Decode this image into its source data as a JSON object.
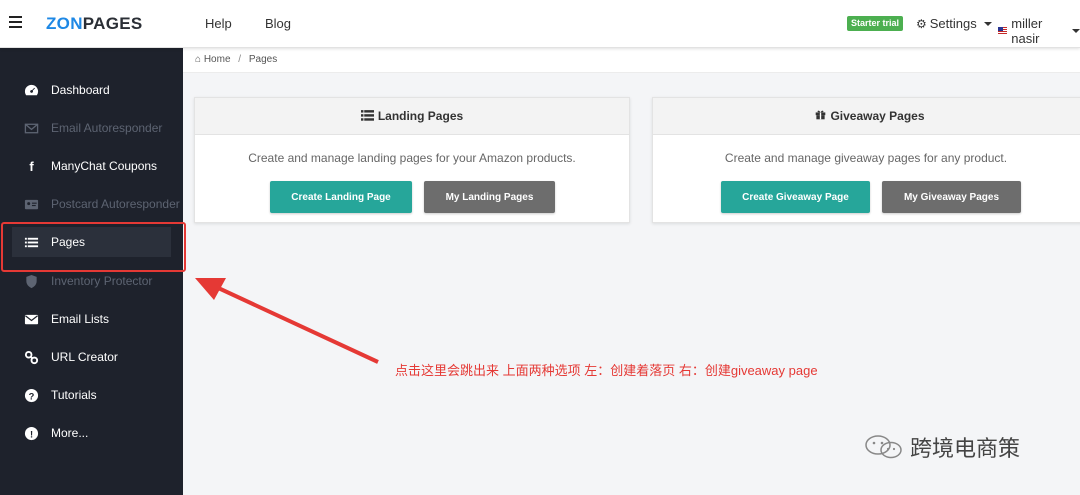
{
  "header": {
    "logo_zon": "ZON",
    "logo_pages": "PAGES",
    "nav": [
      "Help",
      "Blog"
    ],
    "trial_badge": "Starter trial",
    "settings_label": "Settings",
    "user_name": "miller nasir"
  },
  "sidebar": {
    "items": [
      {
        "label": "Dashboard",
        "icon": "dashboard-icon",
        "state": "normal"
      },
      {
        "label": "Email Autoresponder",
        "icon": "envelope-icon",
        "state": "dim"
      },
      {
        "label": "ManyChat Coupons",
        "icon": "facebook-icon",
        "state": "normal"
      },
      {
        "label": "Postcard Autoresponder",
        "icon": "address-card-icon",
        "state": "dim"
      },
      {
        "label": "Pages",
        "icon": "list-icon",
        "state": "active"
      },
      {
        "label": "Inventory Protector",
        "icon": "shield-icon",
        "state": "dim"
      },
      {
        "label": "Email Lists",
        "icon": "envelope-icon",
        "state": "normal"
      },
      {
        "label": "URL Creator",
        "icon": "link-icon",
        "state": "normal"
      },
      {
        "label": "Tutorials",
        "icon": "question-icon",
        "state": "normal"
      },
      {
        "label": "More...",
        "icon": "exclamation-icon",
        "state": "normal"
      }
    ]
  },
  "breadcrumb": {
    "home": "Home",
    "current": "Pages"
  },
  "cards": {
    "landing": {
      "title": "Landing Pages",
      "description": "Create and manage landing pages for your Amazon products.",
      "primary_button": "Create Landing Page",
      "secondary_button": "My Landing Pages"
    },
    "giveaway": {
      "title": "Giveaway Pages",
      "description": "Create and manage giveaway pages for any product.",
      "primary_button": "Create Giveaway Page",
      "secondary_button": "My Giveaway Pages"
    }
  },
  "annotation": "点击这里会跳出来 上面两种选项  左：创建着落页  右：创建giveaway page",
  "watermark": "跨境电商策",
  "colors": {
    "accent": "#1e88e5",
    "teal": "#26a69a",
    "sidebar": "#1e222c",
    "annotation": "#e53935",
    "badge": "#4caf50"
  }
}
